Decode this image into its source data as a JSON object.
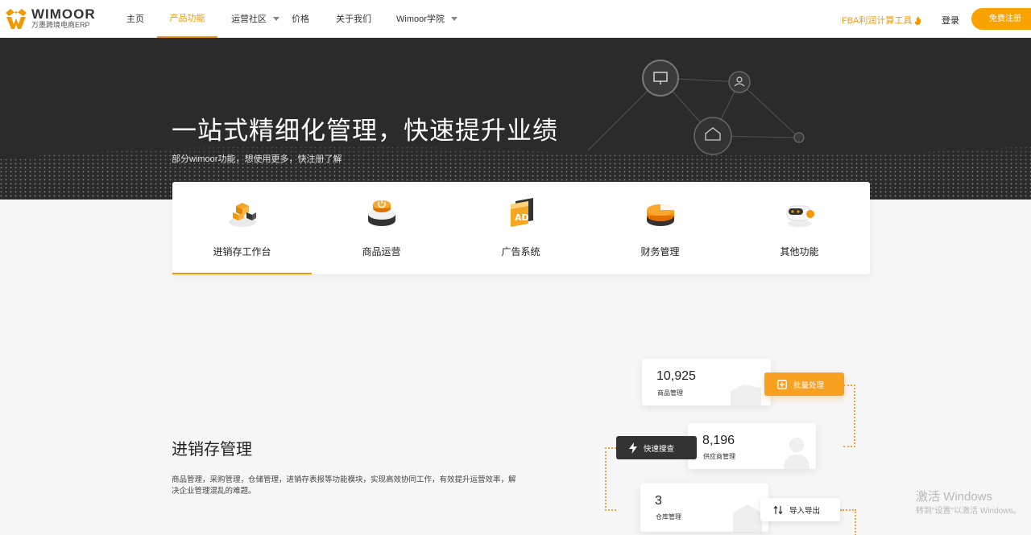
{
  "brand": {
    "name": "WIMOOR",
    "sub": "万墨跨境电商ERP"
  },
  "nav": {
    "items": [
      {
        "label": "主页"
      },
      {
        "label": "产品功能"
      },
      {
        "label": "运营社区"
      },
      {
        "label": "价格"
      },
      {
        "label": "关于我们"
      },
      {
        "label": "Wimoor学院"
      }
    ],
    "active": "产品功能",
    "fba_tool": "FBA利润计算工具",
    "login": "登录",
    "signup": "免费注册"
  },
  "hero": {
    "title": "一站式精细化管理，快速提升业绩",
    "subtitle": "部分wimoor功能，想使用更多，快注册了解"
  },
  "feature_tabs": [
    {
      "label": "进销存工作台",
      "icon": "inventory-blocks-icon"
    },
    {
      "label": "商品运营",
      "icon": "power-button-icon"
    },
    {
      "label": "广告系统",
      "icon": "ad-icon"
    },
    {
      "label": "财务管理",
      "icon": "finance-disc-icon"
    },
    {
      "label": "其他功能",
      "icon": "robot-icon"
    }
  ],
  "section": {
    "title": "进销存管理",
    "description": "商品管理，采购管理，仓储管理，进销存表报等功能模块，实现高效协同工作，有效提升运营效率，解决企业管理混乱的难题。"
  },
  "illustration": {
    "stats": [
      {
        "value": "10,925",
        "label": "商品管理"
      },
      {
        "value": "8,196",
        "label": "供应商管理"
      },
      {
        "value": "3",
        "label": "仓库管理"
      }
    ],
    "pills": {
      "batch": "批量处理",
      "search": "快速搜查",
      "import_export": "导入导出"
    }
  },
  "os_watermark": {
    "line1": "激活 Windows",
    "line2": "转到\"设置\"以激活 Windows。"
  },
  "colors": {
    "accent": "#f39800",
    "hero_bg": "#2b2b2b",
    "page_bg": "#f6f6f6"
  }
}
